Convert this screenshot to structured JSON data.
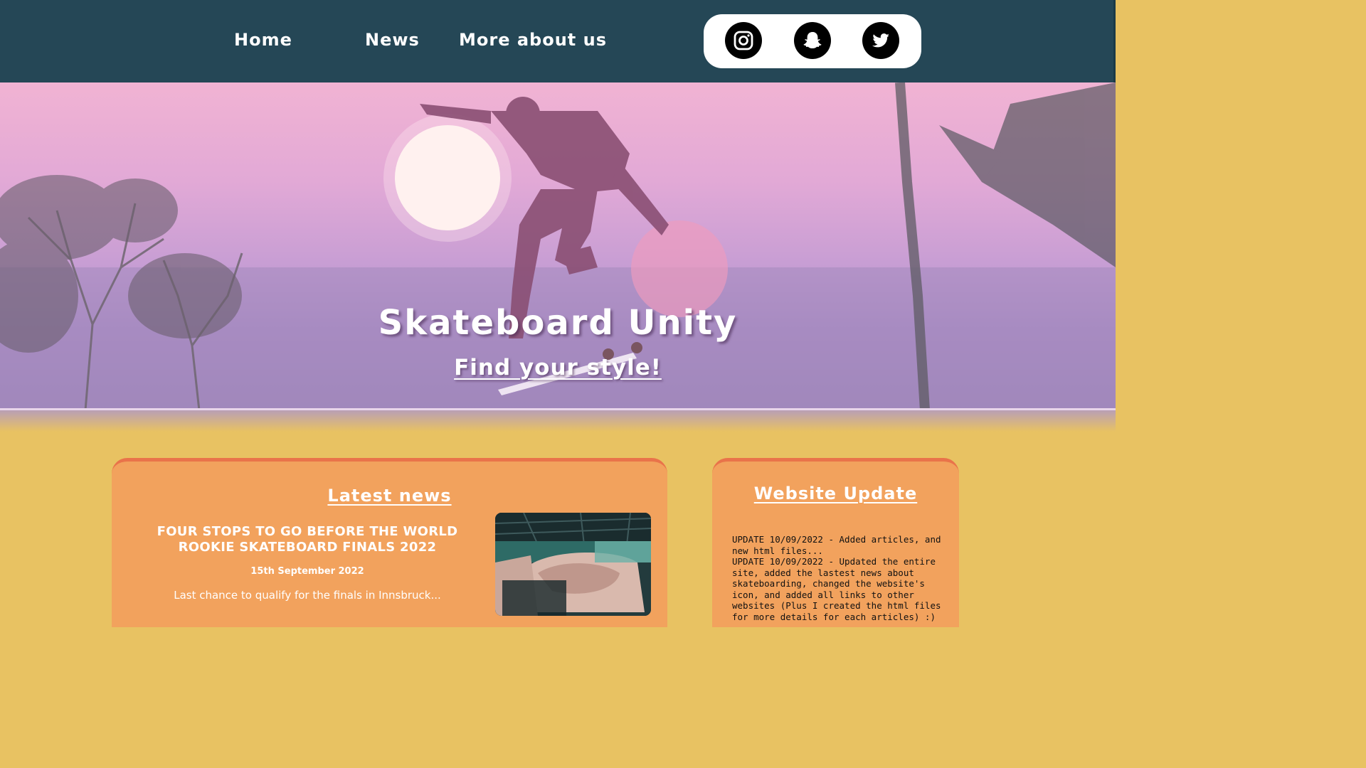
{
  "nav": {
    "links": [
      "Home",
      "News",
      "More about us"
    ],
    "social": [
      "instagram-icon",
      "snapchat-icon",
      "twitter-icon"
    ]
  },
  "hero": {
    "title": "Skateboard Unity",
    "subtitle": "Find your style!"
  },
  "news": {
    "heading": "Latest news",
    "article_title": "FOUR STOPS TO GO BEFORE THE WORLD ROOKIE SKATEBOARD FINALS 2022",
    "article_date": "15th September 2022",
    "article_excerpt": "Last chance to qualify for the finals in Innsbruck..."
  },
  "update": {
    "heading": "Website Update",
    "text": "UPDATE 10/09/2022 - Added articles, and new html files...\nUPDATE 10/09/2022 - Updated the entire site, added the lastest news about skateboarding, changed the website's icon, and added all links to other websites (Plus I created the html files for more details for each articles) :)"
  },
  "colors": {
    "nav_bg": "#254756",
    "page_bg": "#e8c262",
    "card_bg": "#f2a25d",
    "card_border": "#e9734a"
  }
}
